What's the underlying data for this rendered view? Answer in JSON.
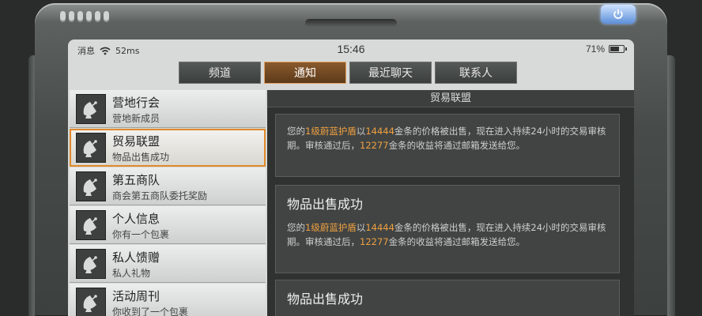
{
  "status": {
    "carrier": "消息",
    "signal": "52ms",
    "time": "15:46",
    "battery": "71%",
    "battery_level": 0.71
  },
  "tabs": [
    {
      "label": "频道"
    },
    {
      "label": "通知"
    },
    {
      "label": "最近聊天"
    },
    {
      "label": "联系人"
    }
  ],
  "active_tab": "通知",
  "list": [
    {
      "title": "营地行会",
      "subtitle": "营地新成员"
    },
    {
      "title": "贸易联盟",
      "subtitle": "物品出售成功"
    },
    {
      "title": "第五商队",
      "subtitle": "商会第五商队委托奖励"
    },
    {
      "title": "个人信息",
      "subtitle": "你有一个包裹"
    },
    {
      "title": "私人馈赠",
      "subtitle": "私人礼物"
    },
    {
      "title": "活动周刊",
      "subtitle": "你收到了一个包裹"
    }
  ],
  "detail": {
    "header": "贸易联盟",
    "messages": [
      {
        "title": "",
        "p1": "您的",
        "item": "1级蔚蓝护盾",
        "p2": "以",
        "price": "14444",
        "p3": "金条的价格被出售，现在进入持续24小时的交易审核期。审核通过后，",
        "income": "12277",
        "p4": "金条的收益将通过邮箱发送给您。"
      },
      {
        "title": "物品出售成功",
        "p1": "您的",
        "item": "1级蔚蓝护盾",
        "p2": "以",
        "price": "14444",
        "p3": "金条的价格被出售，现在进入持续24小时的交易审核期。审核通过后，",
        "income": "12277",
        "p4": "金条的收益将通过邮箱发送给您。"
      },
      {
        "title": "物品出售成功"
      }
    ]
  },
  "colors": {
    "accent": "#e08a2c",
    "highlight_text": "#f0a040"
  },
  "icons": {
    "list_item": "satellite-dish-icon",
    "power": "power-icon",
    "wifi": "wifi-icon",
    "battery": "battery-icon"
  }
}
